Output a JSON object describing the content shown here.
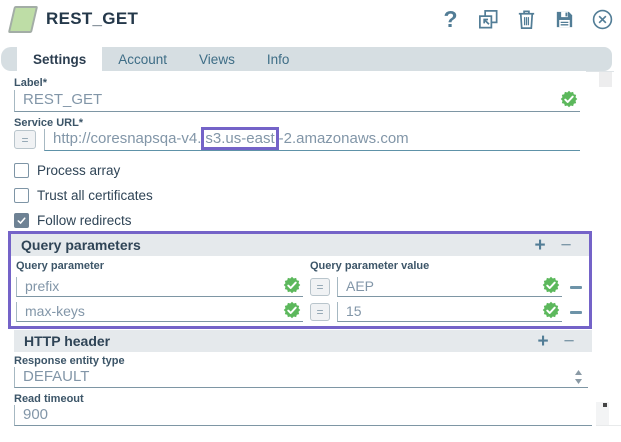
{
  "window": {
    "title": "REST_GET"
  },
  "toolbar": {
    "help_glyph": "?",
    "icons": [
      "help-icon",
      "popout-icon",
      "trash-icon",
      "save-icon",
      "close-icon"
    ]
  },
  "tabs": [
    {
      "label": "Settings",
      "active": true
    },
    {
      "label": "Account",
      "active": false
    },
    {
      "label": "Views",
      "active": false
    },
    {
      "label": "Info",
      "active": false
    }
  ],
  "fields": {
    "label": {
      "label": "Label*",
      "value": "REST_GET",
      "valid": true
    },
    "service_url": {
      "label": "Service URL*",
      "expression_toggle": "=",
      "value_prefix": "http://coresnapsqa-v4.",
      "value_highlight": "s3.us-east",
      "value_suffix": "-2.amazonaws.com"
    },
    "checkboxes": [
      {
        "label": "Process array",
        "checked": false
      },
      {
        "label": "Trust all certificates",
        "checked": false
      },
      {
        "label": "Follow redirects",
        "checked": true
      }
    ],
    "response_entity_type": {
      "label": "Response entity type",
      "value": "DEFAULT"
    },
    "read_timeout": {
      "label": "Read timeout",
      "value": "900"
    }
  },
  "query_parameters": {
    "title": "Query parameters",
    "add_label": "+",
    "remove_label": "−",
    "columns": [
      "Query parameter",
      "Query parameter value"
    ],
    "rows": [
      {
        "param": "prefix",
        "expression_toggle": "=",
        "value": "AEP",
        "param_valid": true,
        "value_valid": true
      },
      {
        "param": "max-keys",
        "expression_toggle": "=",
        "value": "15",
        "param_valid": true,
        "value_valid": true
      }
    ]
  },
  "http_header": {
    "title": "HTTP header",
    "add_label": "+",
    "remove_label": "−"
  },
  "colors": {
    "accent_purple": "#7463c8",
    "valid_green": "#5cb85c",
    "icon_slate": "#527d96",
    "tab_bar": "#d6dee2",
    "section_bar": "#e5e9ec"
  }
}
